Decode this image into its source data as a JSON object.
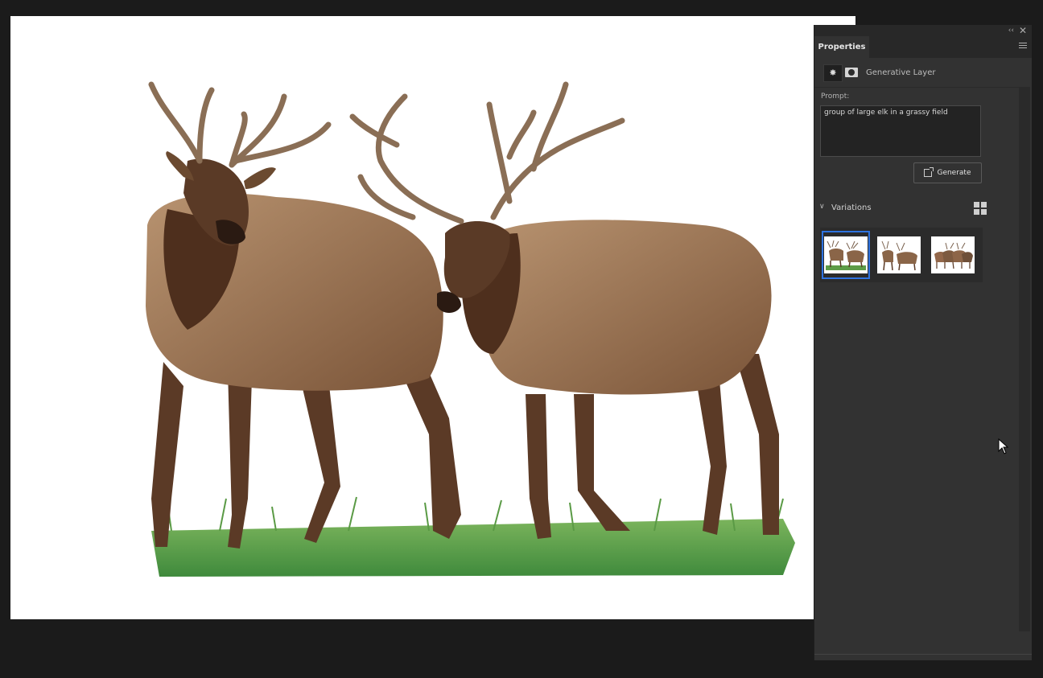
{
  "panel": {
    "tab_label": "Properties",
    "layer_type": "Generative Layer",
    "prompt_label": "Prompt:",
    "prompt_value": "group of large elk in a grassy field",
    "generate_label": "Generate",
    "variations_label": "Variations",
    "variation_count": 3,
    "selected_variation": 0
  },
  "canvas": {
    "image_subject": "two elk standing in grass",
    "background": "#ffffff"
  },
  "colors": {
    "app_bg": "#1b1b1b",
    "panel_bg": "#323232",
    "selection_accent": "#2e73e0"
  },
  "icons": {
    "collapse": "double-chevron-left-icon",
    "close": "close-icon",
    "panel_menu": "hamburger-menu-icon",
    "generative_layer": "generative-ai-icon",
    "mask": "layer-mask-icon",
    "generate": "generate-icon",
    "expand": "chevron-down-icon",
    "grid_view": "grid-view-icon"
  }
}
